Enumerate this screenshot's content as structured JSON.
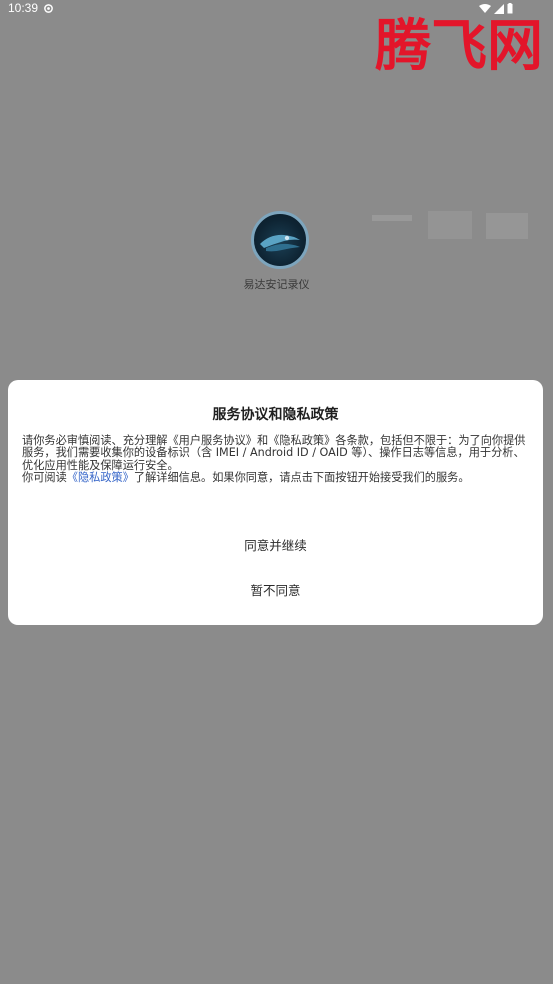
{
  "status_bar": {
    "time": "10:39",
    "icons": [
      "gear-icon",
      "wifi-icon",
      "signal-icon",
      "battery-icon"
    ]
  },
  "watermark": {
    "text": "腾飞网",
    "color": "#e3152a"
  },
  "app": {
    "name": "易达安记录仪",
    "logo": "app-logo-icon"
  },
  "dialog": {
    "title": "服务协议和隐私政策",
    "body_line1": "请你务必审慎阅读、充分理解《用户服务协议》和《隐私政策》各条款，包括但不限于：为了向你提供服务，我们需要收集你的设备标识（含 IMEI / Android ID / OAID 等）、操作日志等信息，用于分析、优化应用性能及保障运行安全。",
    "body_line2_prefix": "你可阅读",
    "body_link": "《隐私政策》",
    "body_line2_suffix": "了解详细信息。如果你同意，请点击下面按钮开始接受我们的服务。",
    "agree_label": "同意并继续",
    "disagree_label": "暂不同意"
  },
  "colors": {
    "background": "#8b8b8b",
    "dialog": "#ffffff",
    "link": "#3565c8"
  }
}
